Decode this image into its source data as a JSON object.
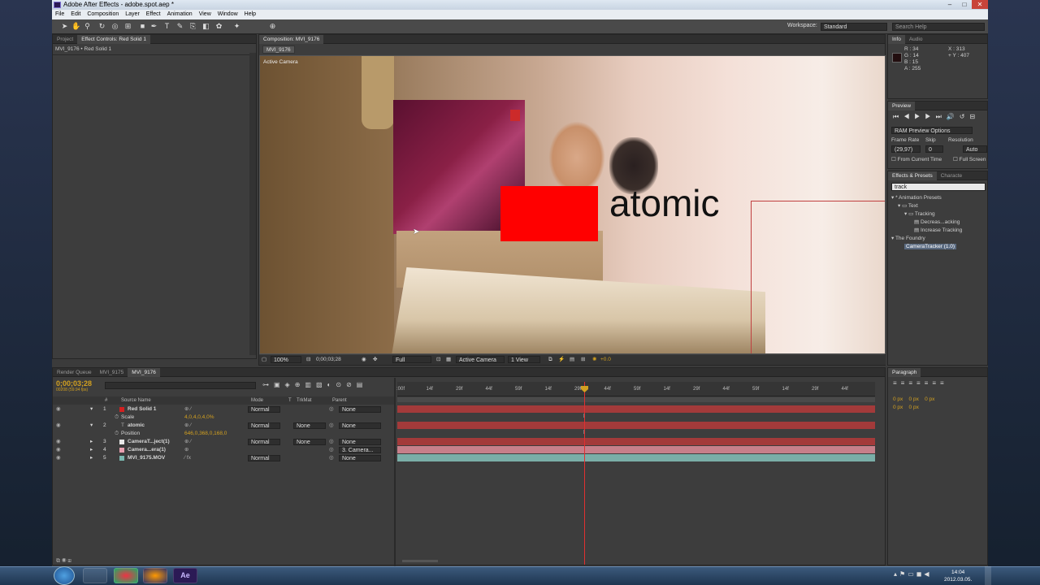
{
  "window": {
    "title": "Adobe After Effects - adobe.spot.aep *",
    "controls": [
      "–",
      "□",
      "✕"
    ]
  },
  "menu": [
    "File",
    "Edit",
    "Composition",
    "Layer",
    "Effect",
    "Animation",
    "View",
    "Window",
    "Help"
  ],
  "toolbar": {
    "workspace_label": "Workspace:",
    "workspace_value": "Standard",
    "search_placeholder": "Search Help"
  },
  "left_panel": {
    "tabs": [
      "Project",
      "Effect Controls: Red Solid 1"
    ],
    "breadcrumb": "MVI_9176 • Red Solid 1"
  },
  "composition": {
    "tab_label": "Composition: MVI_9176",
    "sub_tab": "MVI_9176",
    "view_label": "Active Camera",
    "overlay_text": "atomic",
    "footer": {
      "zoom": "100%",
      "timecode": "0;00;03;28",
      "resolution": "Full",
      "camera": "Active Camera",
      "views": "1 View",
      "exposure": "+0.0"
    }
  },
  "info_panel": {
    "tabs": [
      "Info",
      "Audio"
    ],
    "r": "R : 34",
    "g": "G : 14",
    "b": "B : 15",
    "a": "A : 255",
    "x": "X : 313",
    "y": "+ Y : 407",
    "swatch_color": "#220e0f"
  },
  "preview_panel": {
    "title": "Preview",
    "ram_preview": "RAM Preview Options",
    "frame_rate_label": "Frame Rate",
    "skip_label": "Skip",
    "resolution_label": "Resolution",
    "frame_rate_value": "(29,97)",
    "skip_value": "0",
    "resolution_value": "Auto",
    "from_current": "From Current Time",
    "full_screen": "Full Screen"
  },
  "effects_panel": {
    "tabs": [
      "Effects & Presets",
      "Characte"
    ],
    "search_value": "track",
    "tree": [
      {
        "label": "* Animation Presets",
        "indent": 0
      },
      {
        "label": "Text",
        "indent": 1
      },
      {
        "label": "Tracking",
        "indent": 2
      },
      {
        "label": "Decreas...acking",
        "indent": 3
      },
      {
        "label": "Increase Tracking",
        "indent": 3
      },
      {
        "label": "The Foundry",
        "indent": 0
      },
      {
        "label": "CameraTracker (1.0)",
        "indent": 1
      }
    ]
  },
  "paragraph_panel": {
    "title": "Paragraph",
    "fields": [
      "0 px",
      "0 px",
      "0 px",
      "0 px",
      "0 px"
    ]
  },
  "timeline": {
    "tabs": [
      "Render Queue",
      "MVI_9175",
      "MVI_9176"
    ],
    "timecode": "0;00;03;28",
    "frame_info": "00208 (59.94 fps)",
    "search_placeholder": "",
    "columns": {
      "num": "#",
      "source": "Source Name",
      "mode": "Mode",
      "t": "T",
      "trkmat": "TrkMat",
      "parent": "Parent"
    },
    "layers": [
      {
        "num": "1",
        "name": "Red Solid 1",
        "color": "#d42020",
        "mode": "Normal",
        "trkmat": "",
        "parent": "None"
      },
      {
        "num": "",
        "name": "Scale",
        "value": "4,0,4,0,4,0%",
        "sub": true
      },
      {
        "num": "2",
        "name": "atomic",
        "color": "#d42020",
        "mode": "Normal",
        "trkmat": "None",
        "parent": "None",
        "text": true
      },
      {
        "num": "",
        "name": "Position",
        "value": "646,0,368,0,168,0",
        "sub": true
      },
      {
        "num": "3",
        "name": "CameraT...ject(1)",
        "color": "#e8e8e8",
        "mode": "Normal",
        "trkmat": "None",
        "parent": "None"
      },
      {
        "num": "4",
        "name": "Camera...era(1)",
        "color": "#e8a0b0",
        "mode": "",
        "trkmat": "",
        "parent": "3. Camera..."
      },
      {
        "num": "5",
        "name": "MVI_9175.MOV",
        "color": "#7ab8b0",
        "mode": "Normal",
        "trkmat": "",
        "parent": "None"
      }
    ],
    "ruler_labels": [
      ":00f",
      "14f",
      "29f",
      "44f",
      "59f",
      "14f",
      "29f",
      "44f",
      "59f",
      "14f",
      "29f",
      "44f",
      "59f",
      "14f",
      "29f",
      "44f"
    ],
    "bar_colors": {
      "red": "#a33a3a",
      "pink": "#c77f8a",
      "teal": "#7aaea8"
    }
  },
  "taskbar": {
    "time": "14:04",
    "date": "2012.03.05."
  }
}
